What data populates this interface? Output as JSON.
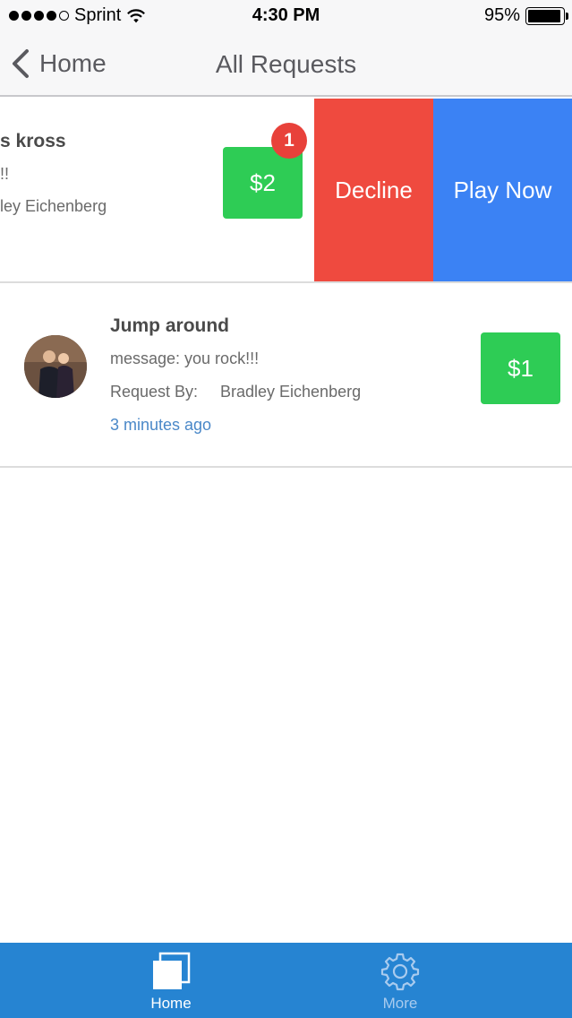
{
  "status_bar": {
    "carrier": "Sprint",
    "time": "4:30 PM",
    "battery": "95%",
    "battery_level": 0.95,
    "signal_dots_filled": 4,
    "signal_dots_total": 5
  },
  "nav": {
    "back_label": "Home",
    "title": "All Requests"
  },
  "requests": [
    {
      "title_partial": "s kross",
      "message_partial": "!!",
      "requester_partial": "ley Eichenberg",
      "amount": "$2",
      "badge": "1",
      "swipe_actions": {
        "decline": "Decline",
        "play": "Play Now"
      }
    },
    {
      "title": "Jump around",
      "message": "message:  you rock!!!",
      "requester_label": "Request By:",
      "requester_name": "Bradley Eichenberg",
      "time": "3 minutes ago",
      "amount": "$1"
    }
  ],
  "tab_bar": {
    "home_label": "Home",
    "more_label": "More"
  },
  "colors": {
    "amount_green": "#2ecc55",
    "decline_red": "#ef4a3f",
    "play_blue": "#3b82f4",
    "badge_red": "#e8413a",
    "tab_bar_blue": "#2684d2",
    "time_link_blue": "#4a88c8"
  },
  "icons": {
    "back": "chevron-left-icon",
    "home_tab": "stacked-squares-icon",
    "more_tab": "gear-icon",
    "wifi": "wifi-icon",
    "battery": "battery-icon"
  }
}
